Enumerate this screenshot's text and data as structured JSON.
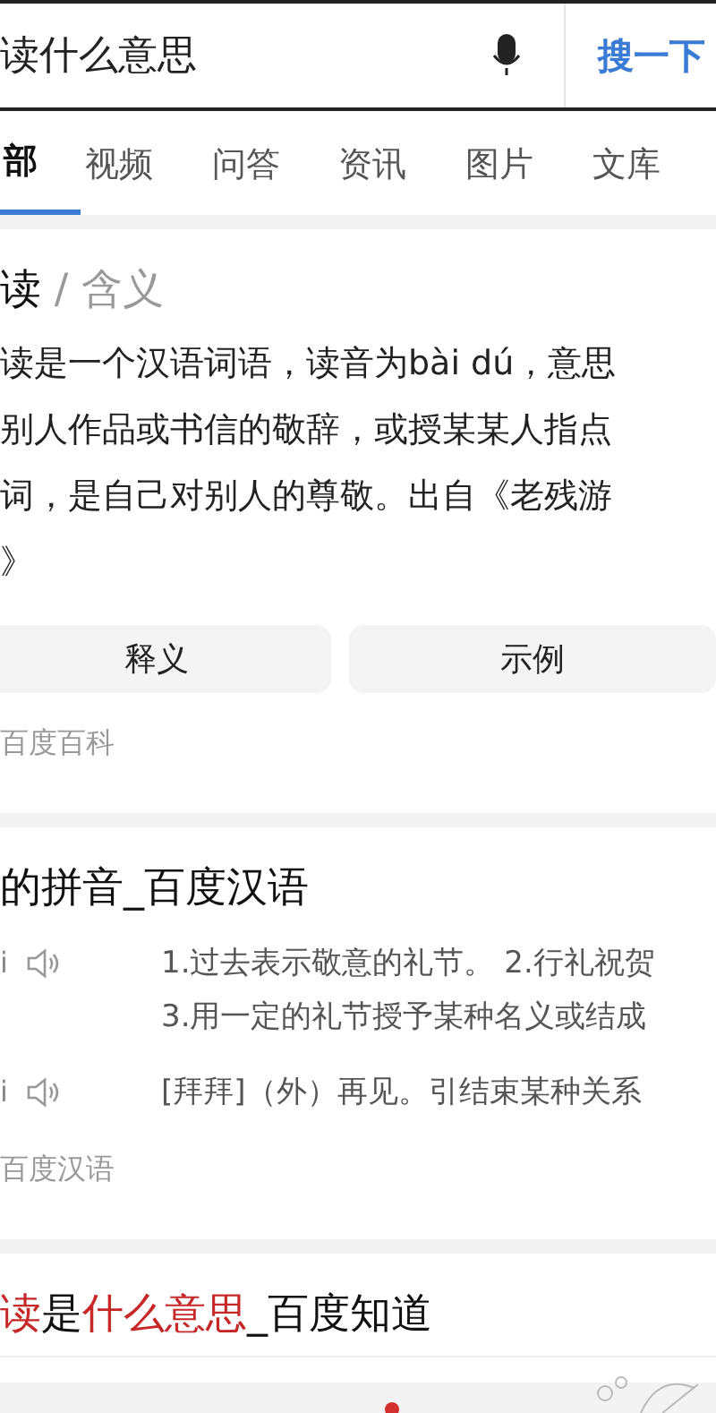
{
  "search": {
    "query": "读什么意思",
    "button": "搜一下"
  },
  "tabs": [
    {
      "label": "部",
      "selected": true
    },
    {
      "label": "视频",
      "selected": false
    },
    {
      "label": "问答",
      "selected": false
    },
    {
      "label": "资讯",
      "selected": false
    },
    {
      "label": "图片",
      "selected": false
    },
    {
      "label": "文库",
      "selected": false
    }
  ],
  "cards": [
    {
      "kind": "baike",
      "heading": "读",
      "separator": "/",
      "heading_sub": "含义",
      "lines": [
        "读是一个汉语词语，读音为bài dú，意思",
        "别人作品或书信的敬辞，或授某某人指点",
        "词，是自己对别人的尊敬。出自《老残游",
        "》"
      ],
      "buttons": [
        "释义",
        "示例"
      ],
      "source": "百度百科"
    },
    {
      "kind": "hanyu",
      "title": "的拼音_百度汉语",
      "entries": [
        {
          "pinyin": "i",
          "lines": [
            "1.过去表示敬意的礼节。 2.行礼祝贺",
            "3.用一定的礼节授予某种名义或结成"
          ]
        },
        {
          "pinyin": "i",
          "lines": [
            "[拜拜]（外）再见。引结束某种关系"
          ]
        }
      ],
      "source": "百度汉语"
    },
    {
      "kind": "zhidao",
      "title_parts": [
        {
          "text": "读",
          "highlight": true
        },
        {
          "text": "是",
          "highlight": false
        },
        {
          "text": "什么意思",
          "highlight": true
        },
        {
          "text": "_百度知道",
          "highlight": false
        }
      ]
    }
  ]
}
